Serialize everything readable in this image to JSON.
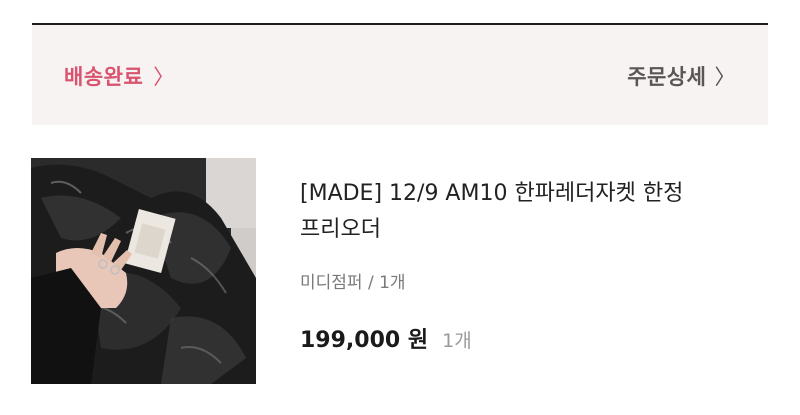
{
  "order": {
    "status_label": "배송완료",
    "status_chevron": "〉",
    "detail_label": "주문상세",
    "detail_chevron": "〉"
  },
  "product": {
    "title": "[MADE] 12/9 AM10 한파레더자켓 한정 프리오더",
    "option": "미디점퍼 / 1개",
    "price": "199,000 원",
    "quantity": "1개",
    "thumbnail_alt": "black leather jacket photo"
  },
  "colors": {
    "status": "#d9536f",
    "background_band": "#f7f3f3",
    "text_primary": "#222222",
    "text_muted": "#9a9a9a"
  }
}
